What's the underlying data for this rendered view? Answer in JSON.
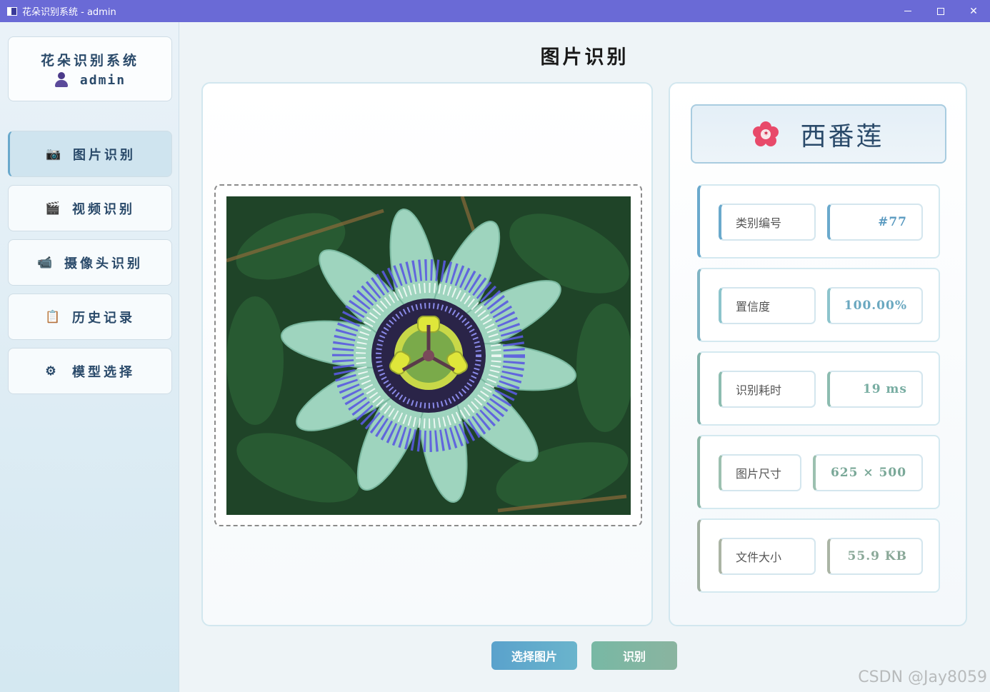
{
  "window": {
    "title": "花朵识别系统 - admin",
    "controls": {
      "minimize": "–",
      "maximize": "☐",
      "close": "✕"
    }
  },
  "sidebar": {
    "system_title": "花朵识别系统",
    "username": "admin",
    "items": [
      {
        "label": "图片识别",
        "icon": "camera-icon",
        "active": true
      },
      {
        "label": "视频识别",
        "icon": "clapperboard-icon",
        "active": false
      },
      {
        "label": "摄像头识别",
        "icon": "video-camera-icon",
        "active": false
      },
      {
        "label": "历史记录",
        "icon": "clipboard-icon",
        "active": false
      },
      {
        "label": "模型选择",
        "icon": "gear-icon",
        "active": false
      }
    ]
  },
  "main": {
    "page_title": "图片识别",
    "image_alt": "passion flower"
  },
  "result": {
    "name": "西番莲",
    "fields": [
      {
        "label": "类别编号",
        "value": "#77"
      },
      {
        "label": "置信度",
        "value": "100.00%"
      },
      {
        "label": "识别耗时",
        "value": "19 ms"
      },
      {
        "label": "图片尺寸",
        "value": "625 × 500"
      },
      {
        "label": "文件大小",
        "value": "55.9 KB"
      }
    ]
  },
  "buttons": {
    "select_image": "选择图片",
    "recognize": "识别"
  },
  "watermark": "CSDN @Jay8059",
  "colors": {
    "titlebar": "#6a6ad6",
    "accent_blue": "#6aa9cc",
    "accent_green": "#78b8a4",
    "flower_red": "#e84a6a"
  }
}
